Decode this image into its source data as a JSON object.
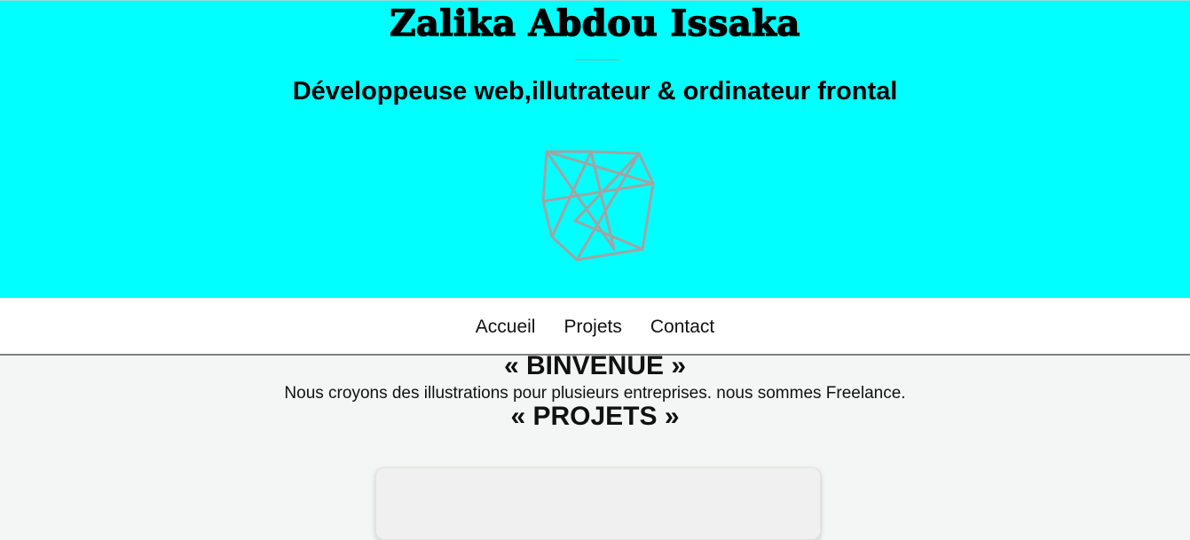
{
  "header": {
    "name": "Zalika Abdou Issaka",
    "subtitle": "Développeuse web,illutrateur & ordinateur frontal",
    "background_color": "#00ffff",
    "logo_icon": "geometric-polygon-icon"
  },
  "nav": {
    "items": [
      {
        "label": "Accueil"
      },
      {
        "label": "Projets"
      },
      {
        "label": "Contact"
      }
    ]
  },
  "main": {
    "welcome_heading": "« BINVENUE »",
    "intro_text": "Nous croyons des illustrations pour plusieurs entreprises. nous sommes Freelance.",
    "projects_heading": "« PROJETS »"
  }
}
